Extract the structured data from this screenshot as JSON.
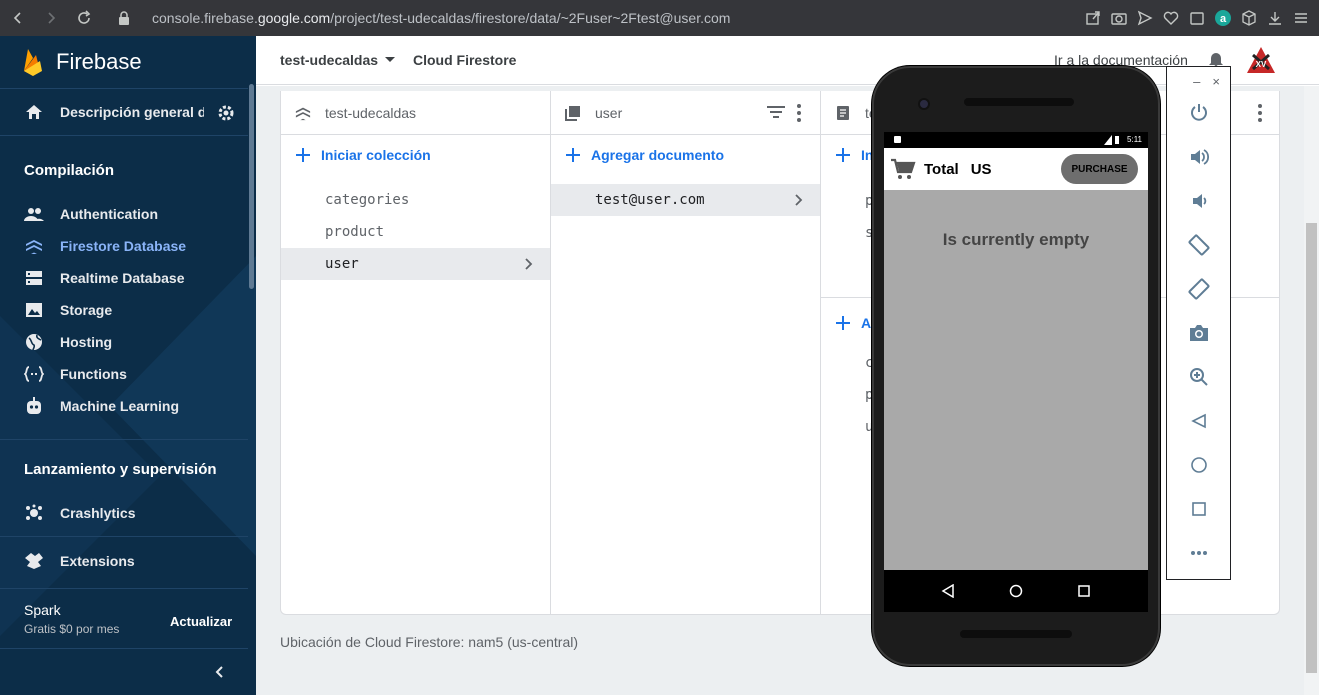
{
  "browser": {
    "url_prefix": "console.firebase.",
    "url_domain": "google.com",
    "url_path": "/project/test-udecaldas/firestore/data/~2Fuser~2Ftest@user.com"
  },
  "sidebar": {
    "brand": "Firebase",
    "overview": "Descripción general del proyecto",
    "section_build": "Compilación",
    "items": [
      {
        "label": "Authentication",
        "icon": "people-icon"
      },
      {
        "label": "Firestore Database",
        "icon": "firestore-icon"
      },
      {
        "label": "Realtime Database",
        "icon": "database-icon"
      },
      {
        "label": "Storage",
        "icon": "image-icon"
      },
      {
        "label": "Hosting",
        "icon": "globe-icon"
      },
      {
        "label": "Functions",
        "icon": "functions-icon"
      },
      {
        "label": "Machine Learning",
        "icon": "robot-icon"
      }
    ],
    "section_release": "Lanzamiento y supervisión",
    "crashlytics": "Crashlytics",
    "extensions": "Extensions",
    "plan_name": "Spark",
    "plan_sub": "Gratis $0 por mes",
    "upgrade": "Actualizar"
  },
  "header": {
    "project": "test-udecaldas",
    "product": "Cloud Firestore",
    "docs": "Ir a la documentación"
  },
  "firestore": {
    "col1": {
      "title": "test-udecaldas",
      "add": "Iniciar colección",
      "rows": [
        "categories",
        "product",
        "user"
      ]
    },
    "col2": {
      "title": "user",
      "add": "Agregar documento",
      "rows": [
        "test@user.com"
      ]
    },
    "col3": {
      "title": "te",
      "add1": "In",
      "fields1": [
        "p",
        "s"
      ],
      "add2": "A",
      "fields2": [
        "c",
        "p",
        "u"
      ]
    },
    "location": "Ubicación de Cloud Firestore: nam5 (us-central)"
  },
  "emulator": {
    "time": "5:11",
    "total_label": "Total",
    "currency": "US",
    "purchase": "PURCHASE",
    "empty_message": "Is currently empty",
    "minimize": "–",
    "close": "×"
  }
}
